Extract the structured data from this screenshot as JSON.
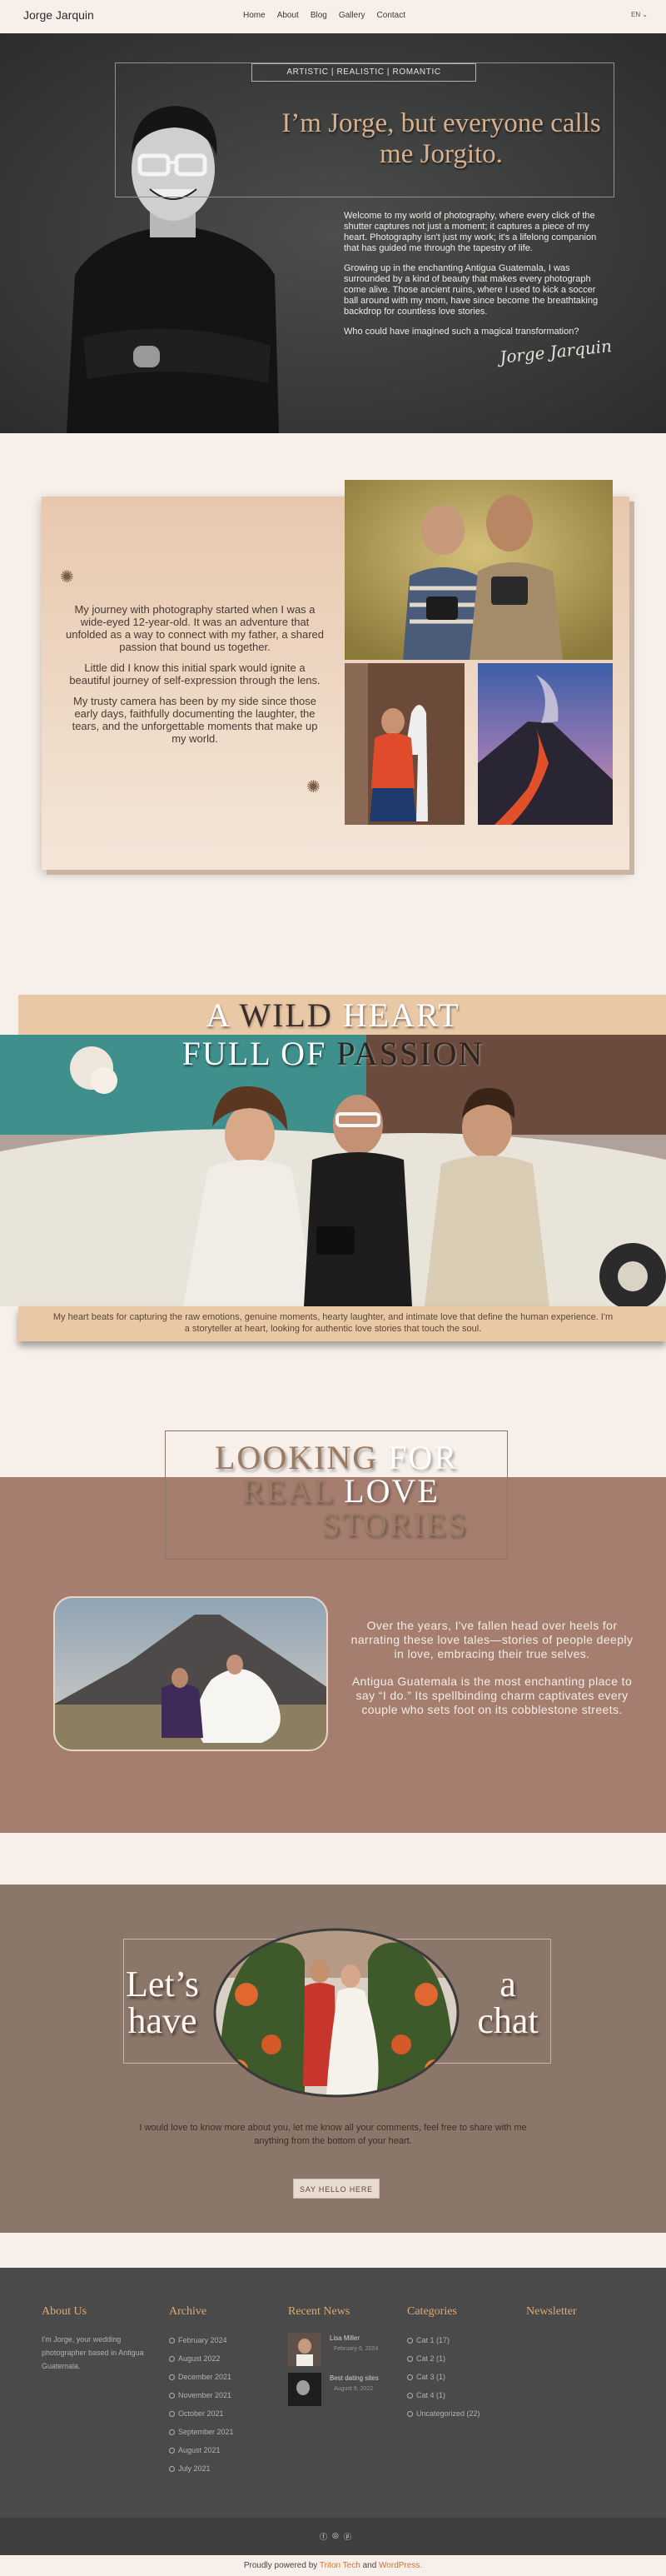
{
  "header": {
    "logo": "Jorge Jarquin",
    "nav": [
      "Home",
      "About",
      "Blog",
      "Gallery",
      "Contact"
    ],
    "lang": "EN ⌄"
  },
  "hero": {
    "tagline": "ARTISTIC | REALISTIC | ROMANTIC",
    "title": "I’m Jorge, but everyone calls me Jorgito.",
    "paragraphs": [
      "Welcome to my world of photography, where every click of the shutter captures not just a moment; it captures a piece of my heart. Photography isn't just my work; it's a lifelong companion that has guided me through the tapestry of life.",
      "Growing up in the enchanting Antigua Guatemala, I was surrounded by a kind of beauty that makes every photograph come alive. Those ancient ruins, where I used to kick a soccer ball around with my mom, have since become the breathtaking backdrop for countless love stories.",
      "Who could have imagined such a magical transformation?"
    ],
    "signature": "Jorge Jarquin"
  },
  "journey": {
    "paragraphs": [
      "My journey with photography started when I was a wide-eyed 12-year-old. It was an adventure that unfolded as a way to connect with my father, a shared passion that bound us together.",
      "Little did I know this initial spark would ignite a beautiful journey of self-expression through the lens.",
      "My trusty camera has been by my side since those early days, faithfully documenting the laughter, the tears, and the unforgettable moments that make up my world."
    ]
  },
  "wild": {
    "line1": [
      "A",
      "WILD",
      "HEART"
    ],
    "line2": [
      "FULL",
      "OF",
      "PASSION"
    ],
    "paragraph": "My heart beats for capturing the raw emotions, genuine moments, hearty laughter, and intimate love that define the human experience. I'm a storyteller at heart, looking for authentic love stories that touch the soul."
  },
  "love": {
    "line1": [
      "LOOKING",
      "FOR"
    ],
    "line2": [
      "REAL",
      "LOVE"
    ],
    "line3": "STORIES",
    "paragraphs": [
      "Over the years, I've fallen head over heels for narrating these love tales—stories of people deeply in love, embracing their true selves.",
      "Antigua Guatemala is the most enchanting place to say “I do.” Its spellbinding charm captivates every couple who sets foot on its cobblestone streets."
    ]
  },
  "chat": {
    "left": [
      "Let’s",
      "have"
    ],
    "right": [
      "a",
      "chat"
    ],
    "paragraph": "I would love to know more about you, let me know all your comments, feel free to share with me anything from the bottom of your heart.",
    "button": "SAY HELLO HERE"
  },
  "footer": {
    "about_title": "About Us",
    "about_text": "I'm Jorge, your wedding photographer based in Antigua Guatemala.",
    "archive_title": "Archive",
    "archive": [
      "February 2024",
      "August 2022",
      "December 2021",
      "November 2021",
      "October 2021",
      "September 2021",
      "August 2021",
      "July 2021"
    ],
    "news_title": "Recent News",
    "news": [
      {
        "title": "Lisa Miller",
        "date": "February 6, 2024"
      },
      {
        "title": "Best dating sites",
        "date": "August 9, 2022"
      }
    ],
    "categories_title": "Categories",
    "categories": [
      "Cat 1 (17)",
      "Cat 2 (1)",
      "Cat 3 (1)",
      "Cat 4 (1)",
      "Uncategorized (22)"
    ],
    "newsletter_title": "Newsletter",
    "credit_prefix": "Proudly powered by",
    "credit_link1": "Triton Tech",
    "credit_and": "and",
    "credit_link2": "WordPress."
  },
  "colors": {
    "accent": "#d9b08c",
    "footer_heading": "#e0a874",
    "page_bg": "#f7efe9",
    "love_bg": "#a57e70",
    "chat_bg": "#8b776a",
    "footer_bg": "#4a4a4a"
  }
}
